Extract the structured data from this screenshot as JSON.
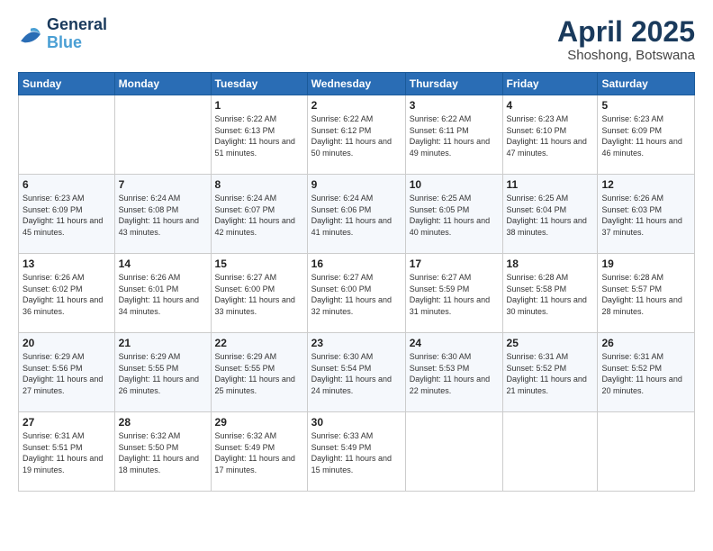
{
  "logo": {
    "line1": "General",
    "line2": "Blue"
  },
  "title": "April 2025",
  "location": "Shoshong, Botswana",
  "weekdays": [
    "Sunday",
    "Monday",
    "Tuesday",
    "Wednesday",
    "Thursday",
    "Friday",
    "Saturday"
  ],
  "weeks": [
    [
      {
        "day": "",
        "content": ""
      },
      {
        "day": "",
        "content": ""
      },
      {
        "day": "1",
        "content": "Sunrise: 6:22 AM\nSunset: 6:13 PM\nDaylight: 11 hours and 51 minutes."
      },
      {
        "day": "2",
        "content": "Sunrise: 6:22 AM\nSunset: 6:12 PM\nDaylight: 11 hours and 50 minutes."
      },
      {
        "day": "3",
        "content": "Sunrise: 6:22 AM\nSunset: 6:11 PM\nDaylight: 11 hours and 49 minutes."
      },
      {
        "day": "4",
        "content": "Sunrise: 6:23 AM\nSunset: 6:10 PM\nDaylight: 11 hours and 47 minutes."
      },
      {
        "day": "5",
        "content": "Sunrise: 6:23 AM\nSunset: 6:09 PM\nDaylight: 11 hours and 46 minutes."
      }
    ],
    [
      {
        "day": "6",
        "content": "Sunrise: 6:23 AM\nSunset: 6:09 PM\nDaylight: 11 hours and 45 minutes."
      },
      {
        "day": "7",
        "content": "Sunrise: 6:24 AM\nSunset: 6:08 PM\nDaylight: 11 hours and 43 minutes."
      },
      {
        "day": "8",
        "content": "Sunrise: 6:24 AM\nSunset: 6:07 PM\nDaylight: 11 hours and 42 minutes."
      },
      {
        "day": "9",
        "content": "Sunrise: 6:24 AM\nSunset: 6:06 PM\nDaylight: 11 hours and 41 minutes."
      },
      {
        "day": "10",
        "content": "Sunrise: 6:25 AM\nSunset: 6:05 PM\nDaylight: 11 hours and 40 minutes."
      },
      {
        "day": "11",
        "content": "Sunrise: 6:25 AM\nSunset: 6:04 PM\nDaylight: 11 hours and 38 minutes."
      },
      {
        "day": "12",
        "content": "Sunrise: 6:26 AM\nSunset: 6:03 PM\nDaylight: 11 hours and 37 minutes."
      }
    ],
    [
      {
        "day": "13",
        "content": "Sunrise: 6:26 AM\nSunset: 6:02 PM\nDaylight: 11 hours and 36 minutes."
      },
      {
        "day": "14",
        "content": "Sunrise: 6:26 AM\nSunset: 6:01 PM\nDaylight: 11 hours and 34 minutes."
      },
      {
        "day": "15",
        "content": "Sunrise: 6:27 AM\nSunset: 6:00 PM\nDaylight: 11 hours and 33 minutes."
      },
      {
        "day": "16",
        "content": "Sunrise: 6:27 AM\nSunset: 6:00 PM\nDaylight: 11 hours and 32 minutes."
      },
      {
        "day": "17",
        "content": "Sunrise: 6:27 AM\nSunset: 5:59 PM\nDaylight: 11 hours and 31 minutes."
      },
      {
        "day": "18",
        "content": "Sunrise: 6:28 AM\nSunset: 5:58 PM\nDaylight: 11 hours and 30 minutes."
      },
      {
        "day": "19",
        "content": "Sunrise: 6:28 AM\nSunset: 5:57 PM\nDaylight: 11 hours and 28 minutes."
      }
    ],
    [
      {
        "day": "20",
        "content": "Sunrise: 6:29 AM\nSunset: 5:56 PM\nDaylight: 11 hours and 27 minutes."
      },
      {
        "day": "21",
        "content": "Sunrise: 6:29 AM\nSunset: 5:55 PM\nDaylight: 11 hours and 26 minutes."
      },
      {
        "day": "22",
        "content": "Sunrise: 6:29 AM\nSunset: 5:55 PM\nDaylight: 11 hours and 25 minutes."
      },
      {
        "day": "23",
        "content": "Sunrise: 6:30 AM\nSunset: 5:54 PM\nDaylight: 11 hours and 24 minutes."
      },
      {
        "day": "24",
        "content": "Sunrise: 6:30 AM\nSunset: 5:53 PM\nDaylight: 11 hours and 22 minutes."
      },
      {
        "day": "25",
        "content": "Sunrise: 6:31 AM\nSunset: 5:52 PM\nDaylight: 11 hours and 21 minutes."
      },
      {
        "day": "26",
        "content": "Sunrise: 6:31 AM\nSunset: 5:52 PM\nDaylight: 11 hours and 20 minutes."
      }
    ],
    [
      {
        "day": "27",
        "content": "Sunrise: 6:31 AM\nSunset: 5:51 PM\nDaylight: 11 hours and 19 minutes."
      },
      {
        "day": "28",
        "content": "Sunrise: 6:32 AM\nSunset: 5:50 PM\nDaylight: 11 hours and 18 minutes."
      },
      {
        "day": "29",
        "content": "Sunrise: 6:32 AM\nSunset: 5:49 PM\nDaylight: 11 hours and 17 minutes."
      },
      {
        "day": "30",
        "content": "Sunrise: 6:33 AM\nSunset: 5:49 PM\nDaylight: 11 hours and 15 minutes."
      },
      {
        "day": "",
        "content": ""
      },
      {
        "day": "",
        "content": ""
      },
      {
        "day": "",
        "content": ""
      }
    ]
  ]
}
